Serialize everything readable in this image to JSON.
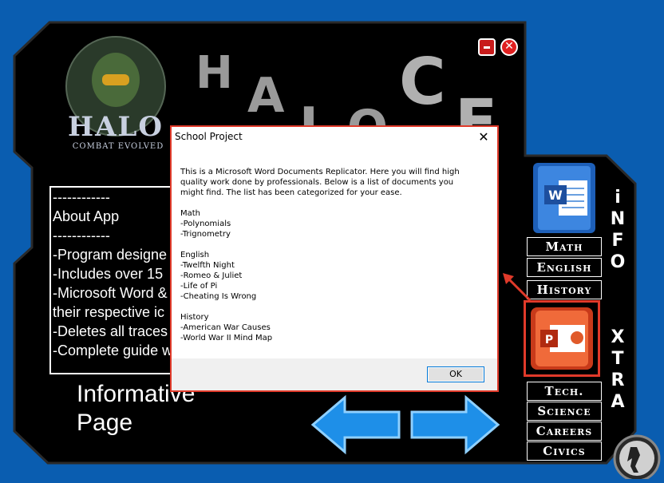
{
  "app": {
    "logo_text": "HALO",
    "logo_subtext": "COMBAT EVOLVED",
    "title_art_text": "HALO CE",
    "minimize_glyph": "–",
    "close_glyph": "✕"
  },
  "info_box": {
    "lines": [
      "------------",
      "About App",
      "------------",
      "-Program designe",
      "-Includes over 15",
      "-Microsoft Word &",
      "their respective ic",
      "-Deletes all traces",
      "-Complete guide w"
    ]
  },
  "page_label": {
    "line1": "Informative",
    "line2": "Page"
  },
  "nav": {
    "top_items": [
      "Math",
      "English",
      "History"
    ],
    "bottom_items": [
      "Tech.",
      "Science",
      "Careers",
      "Civics"
    ],
    "side_top_letters": [
      "i",
      "N",
      "F",
      "O"
    ],
    "side_bottom_letters": [
      "X",
      "T",
      "R",
      "A"
    ]
  },
  "dialog": {
    "title": "School Project",
    "close_glyph": "✕",
    "intro_1": "This is a Microsoft Word Documents Replicator. Here you will find high",
    "intro_2": "quality work done by professionals. Below is a list of documents you",
    "intro_3": "might find. The list has been categorized for your ease.",
    "sections": [
      {
        "heading": "Math",
        "items": [
          "-Polynomials",
          "-Trignometry"
        ]
      },
      {
        "heading": "English",
        "items": [
          "-Twelfth Night",
          "-Romeo & Juliet",
          "-Life of Pi",
          "-Cheating Is Wrong"
        ]
      },
      {
        "heading": "History",
        "items": [
          "-American War Causes",
          "-World War II Mind Map"
        ]
      }
    ],
    "ok_label": "OK"
  },
  "colors": {
    "background": "#0a5db0",
    "highlight": "#e03a2a",
    "arrow": "#1e8fe8"
  }
}
